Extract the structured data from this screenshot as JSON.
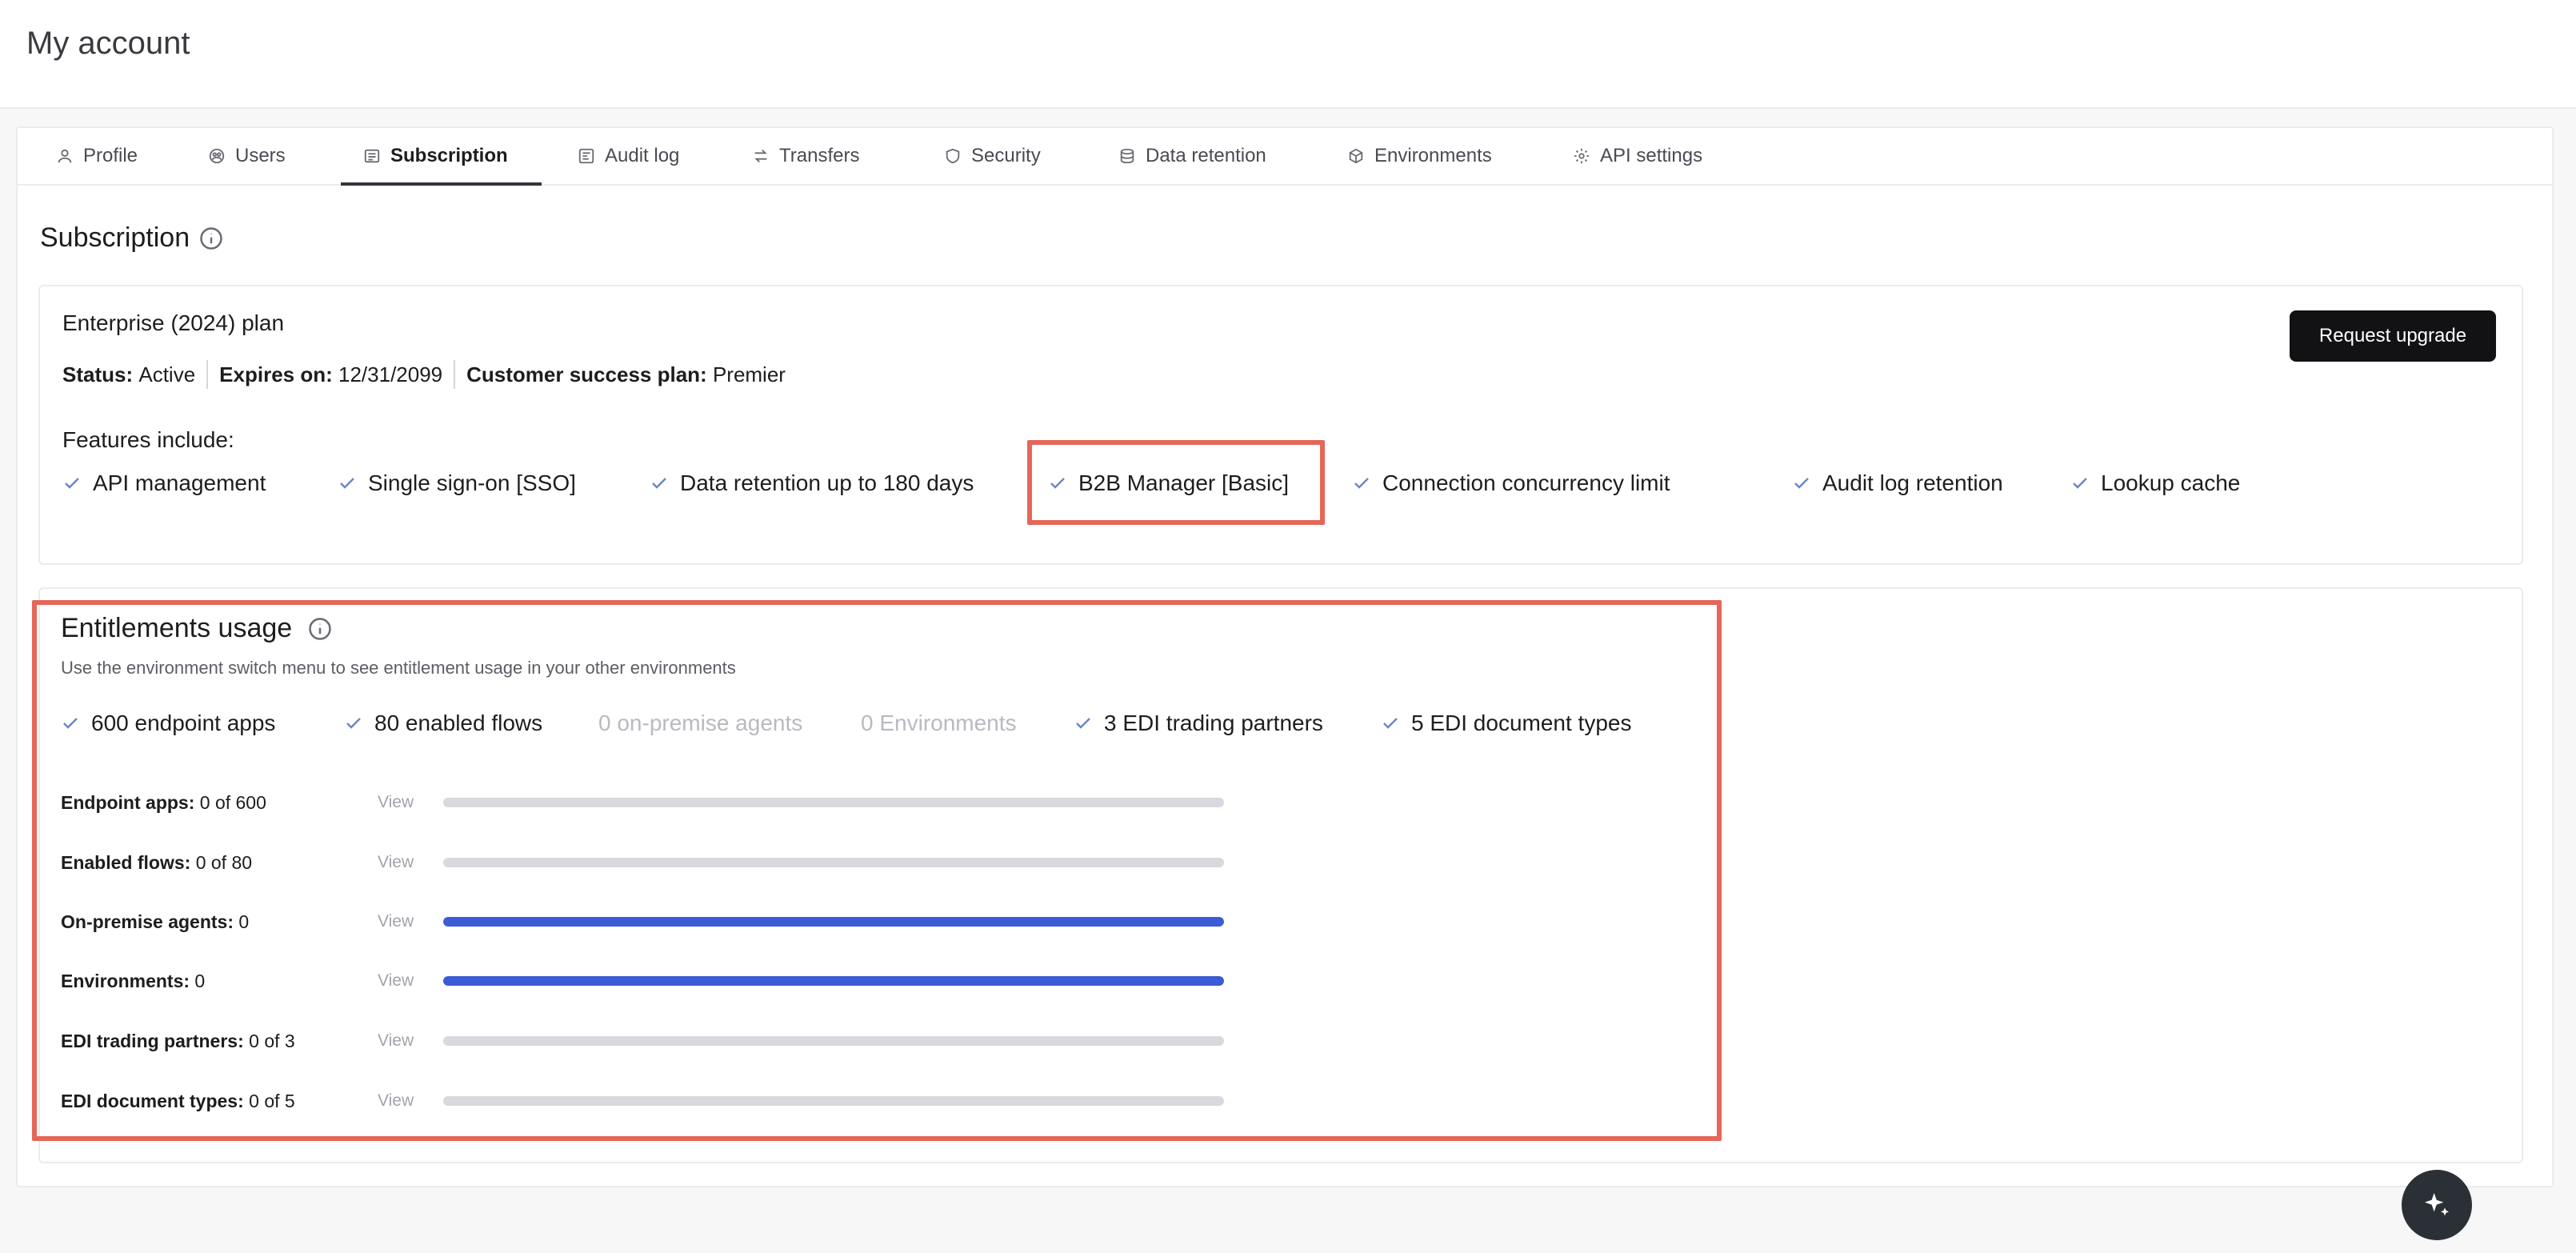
{
  "header": {
    "title": "My account"
  },
  "tabs": [
    {
      "label": "Profile",
      "icon": "user-icon"
    },
    {
      "label": "Users",
      "icon": "users-icon"
    },
    {
      "label": "Subscription",
      "icon": "subscription-icon",
      "active": true
    },
    {
      "label": "Audit log",
      "icon": "audit-log-icon"
    },
    {
      "label": "Transfers",
      "icon": "transfers-icon"
    },
    {
      "label": "Security",
      "icon": "shield-icon"
    },
    {
      "label": "Data retention",
      "icon": "database-icon"
    },
    {
      "label": "Environments",
      "icon": "cube-icon"
    },
    {
      "label": "API settings",
      "icon": "gear-icon"
    }
  ],
  "subscription": {
    "title": "Subscription",
    "plan_name": "Enterprise (2024) plan",
    "status_label": "Status:",
    "status_value": "Active",
    "expires_label": "Expires on:",
    "expires_value": "12/31/2099",
    "csp_label": "Customer success plan:",
    "csp_value": "Premier",
    "features_label": "Features include:",
    "features": [
      "API management",
      "Single sign-on [SSO]",
      "Data retention up to 180 days",
      "B2B Manager [Basic]",
      "Connection concurrency limit",
      "Audit log retention",
      "Lookup cache"
    ],
    "upgrade_button": "Request upgrade"
  },
  "entitlements": {
    "title": "Entitlements usage",
    "description": "Use the environment switch menu to see entitlement usage in your other environments",
    "summary": [
      {
        "text": "600 endpoint apps",
        "enabled": true
      },
      {
        "text": "80 enabled flows",
        "enabled": true
      },
      {
        "text": "0 on-premise agents",
        "enabled": false
      },
      {
        "text": "0 Environments",
        "enabled": false
      },
      {
        "text": "3 EDI trading partners",
        "enabled": true
      },
      {
        "text": "5 EDI document types",
        "enabled": true
      }
    ],
    "view_label": "View",
    "usage": [
      {
        "label": "Endpoint apps:",
        "value": "0 of 600",
        "fill": 0
      },
      {
        "label": "Enabled flows:",
        "value": "0 of 80",
        "fill": 0
      },
      {
        "label": "On-premise agents:",
        "value": "0",
        "fill": 1
      },
      {
        "label": "Environments:",
        "value": "0",
        "fill": 1
      },
      {
        "label": "EDI trading partners:",
        "value": "0 of 3",
        "fill": 0
      },
      {
        "label": "EDI document types:",
        "value": "0 of 5",
        "fill": 0
      }
    ]
  },
  "colors": {
    "accent_bar": "#3c5bd6",
    "highlight": "#e4675a",
    "check": "#6a86c8"
  }
}
